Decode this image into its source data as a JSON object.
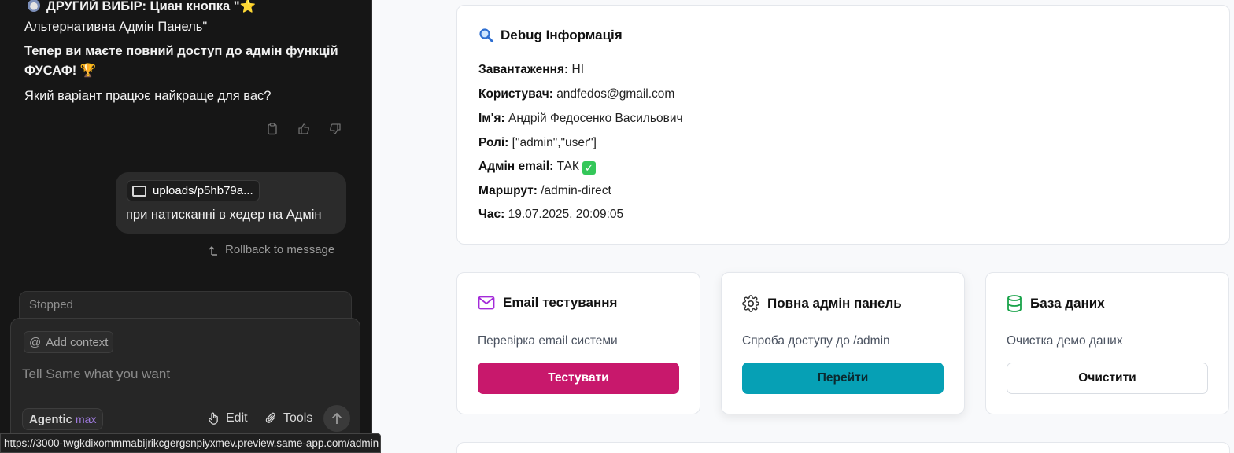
{
  "chat": {
    "message_lines": [
      "ДРУГИЙ ВИБІР: Циан кнопка \"",
      "Альтернативна Адмін Панель\"",
      "Тепер ви маєте повний доступ до адмін функцій",
      "ФУСАФ! ",
      "Який варіант працює найкраще для вас?"
    ],
    "star_glyph": "⭐",
    "trophy_glyph": "🏆",
    "actions": [
      "copy-icon",
      "thumbs-up-icon",
      "thumbs-down-icon"
    ],
    "user_message": {
      "attachment": "uploads/p5hb79a...",
      "text": "при натисканні в хедер на Адмін"
    },
    "rollback_label": "Rollback to message",
    "stopped_label": "Stopped",
    "composer": {
      "add_context_label": "Add context",
      "placeholder": "Tell Same what you want",
      "agentic_label": "Agentic",
      "agentic_badge": "max",
      "edit_label": "Edit",
      "tools_label": "Tools"
    },
    "status_url": "https://3000-twgkdixommmabijrikcgergsnpiyxmev.preview.same-app.com/admin"
  },
  "debug": {
    "title": "Debug Інформація",
    "rows": [
      {
        "label": "Завантаження:",
        "value": "НІ"
      },
      {
        "label": "Користувач:",
        "value": "andfedos@gmail.com"
      },
      {
        "label": "Ім'я:",
        "value": "Андрій Федосенко Васильович"
      },
      {
        "label": "Ролі:",
        "value": "[\"admin\",\"user\"]"
      },
      {
        "label": "Адмін email:",
        "value": "ТАК"
      },
      {
        "label": "Маршрут:",
        "value": "/admin-direct"
      },
      {
        "label": "Час:",
        "value": "19.07.2025, 20:09:05"
      }
    ]
  },
  "tools": [
    {
      "icon": "mail-icon",
      "title": "Email тестування",
      "desc": "Перевірка email системи",
      "button": "Тестувати",
      "color": "#c8186c"
    },
    {
      "icon": "gear-icon",
      "title": "Повна адмін панель",
      "desc": "Спроба доступу до /admin",
      "button": "Перейти",
      "color": "#06a0b5"
    },
    {
      "icon": "database-icon",
      "title": "База даних",
      "desc": "Очистка демо даних",
      "button": "Очистити",
      "color": "#ffffff"
    }
  ]
}
